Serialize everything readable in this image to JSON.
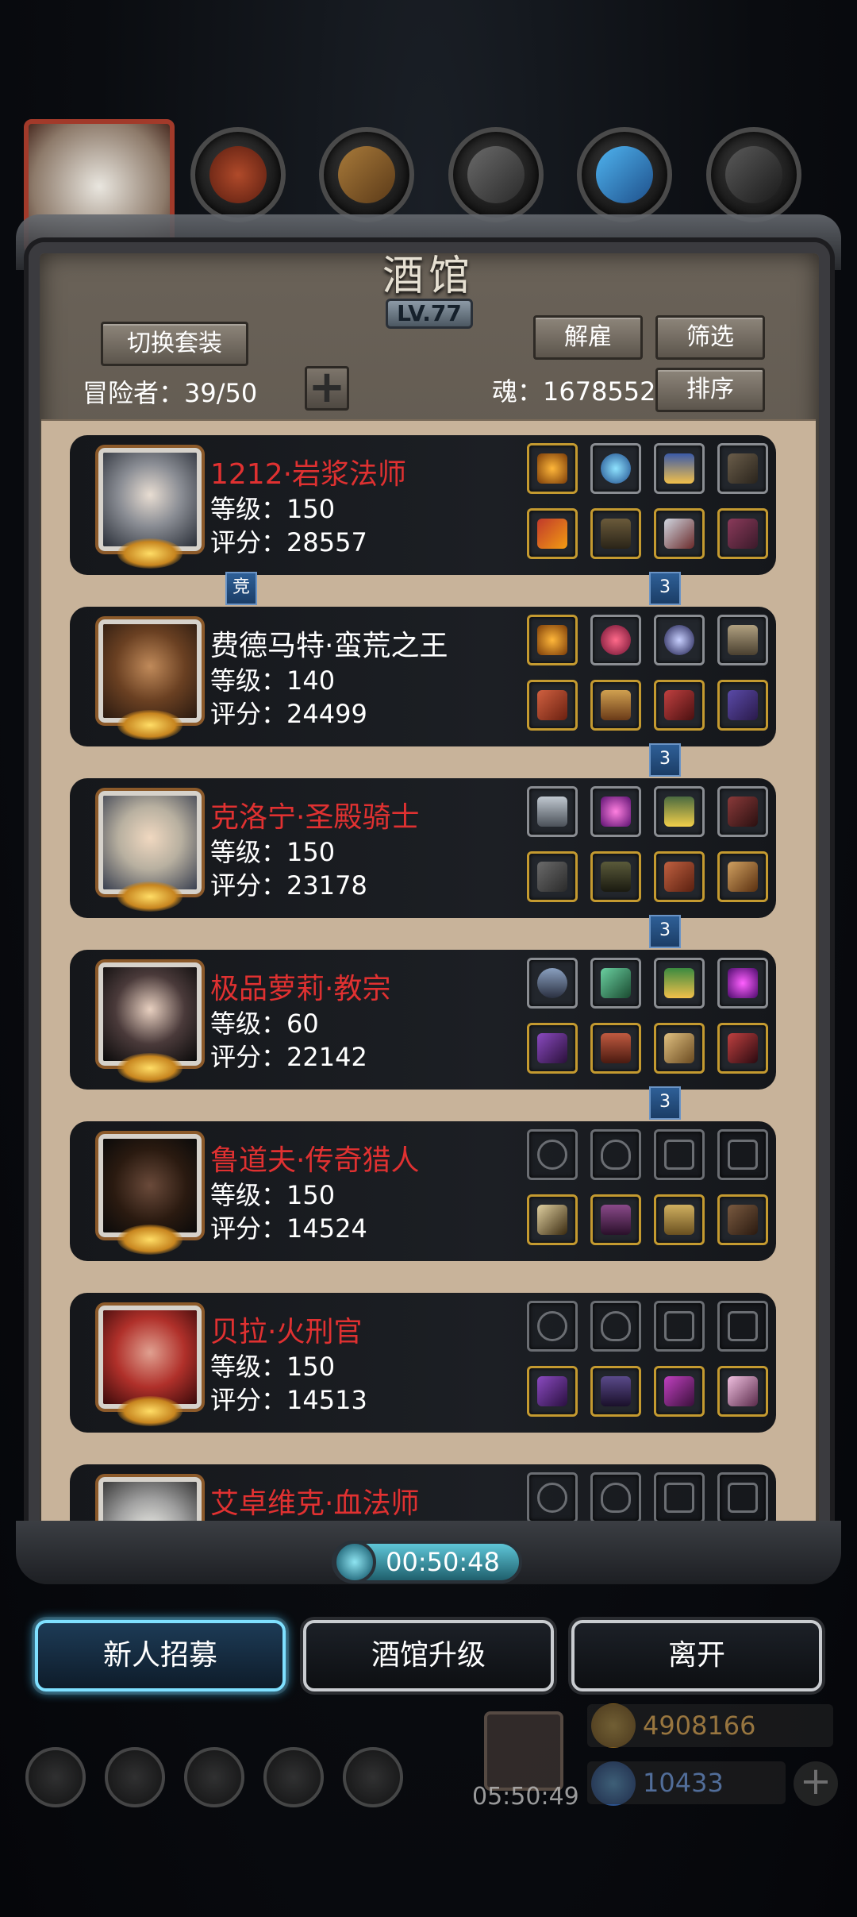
{
  "panel": {
    "title": "酒馆",
    "level": "LV.77",
    "switch_set_label": "切换套装",
    "dismiss_label": "解雇",
    "filter_label": "筛选",
    "sort_label": "排序",
    "adventurers_text": "冒险者：39/50",
    "soul_text": "魂：1678552"
  },
  "heroes": [
    {
      "name": "1212·岩浆法师",
      "level": "等级：150",
      "score": "评分：28557",
      "name_color": "red"
    },
    {
      "name": "费德马特·蛮荒之王",
      "level": "等级：140",
      "score": "评分：24499",
      "name_color": "white"
    },
    {
      "name": "克洛宁·圣殿骑士",
      "level": "等级：150",
      "score": "评分：23178",
      "name_color": "red"
    },
    {
      "name": "极品萝莉·教宗",
      "level": "等级：60",
      "score": "评分：22142",
      "name_color": "red"
    },
    {
      "name": "鲁道夫·传奇猎人",
      "level": "等级：150",
      "score": "评分：14524",
      "name_color": "red"
    },
    {
      "name": "贝拉·火刑官",
      "level": "等级：150",
      "score": "评分：14513",
      "name_color": "red"
    },
    {
      "name": "艾卓维克·血法师",
      "name_color": "red"
    }
  ],
  "tags": {
    "compete": "竞",
    "three": "3"
  },
  "timer": "00:50:48",
  "buttons": {
    "recruit": "新人招募",
    "upgrade": "酒馆升级",
    "leave": "离开"
  },
  "background": {
    "gold": "4908166",
    "diamonds": "10433",
    "gift_timer": "05:50:49"
  }
}
